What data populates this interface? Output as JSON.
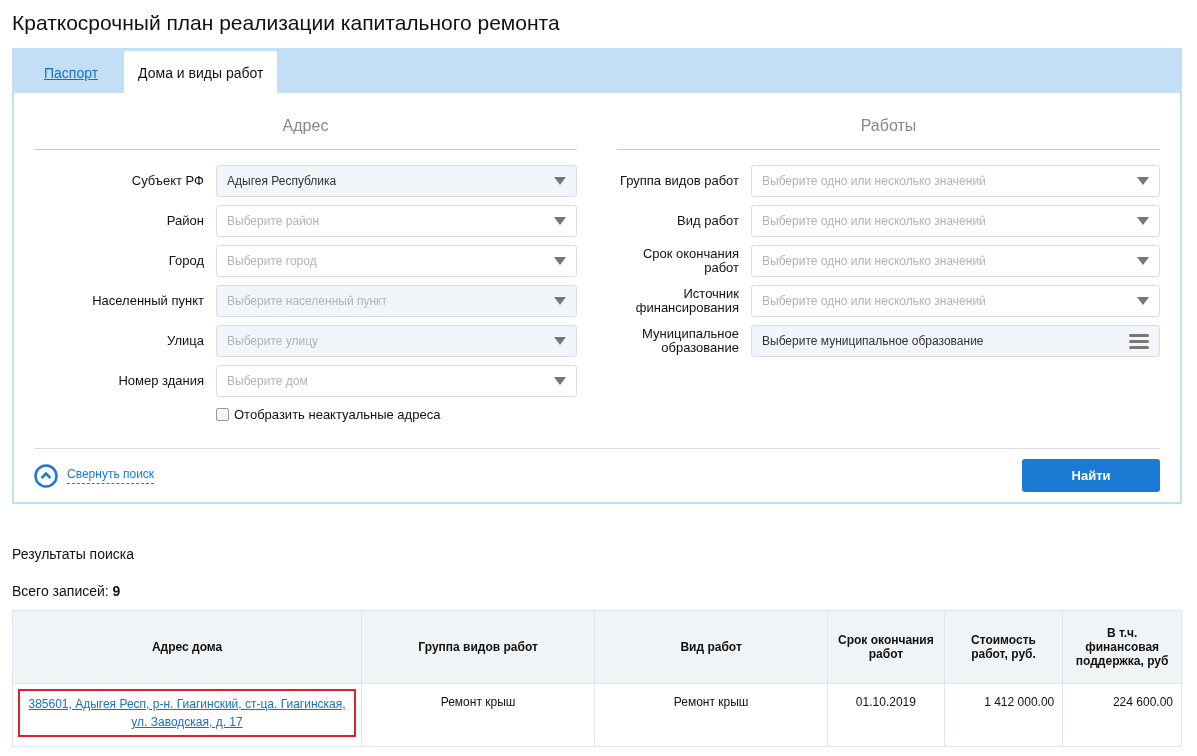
{
  "page_title": "Краткосрочный план реализации капитального ремонта",
  "tabs": [
    {
      "label": "Паспорт",
      "selected": false
    },
    {
      "label": "Дома и виды работ",
      "selected": true
    }
  ],
  "address_section": {
    "heading": "Адрес",
    "fields": [
      {
        "label": "Субъект РФ",
        "kind": "select",
        "value": "Адыгея Республика",
        "disabled": true
      },
      {
        "label": "Район",
        "kind": "select",
        "placeholder": "Выберите район",
        "disabled": false
      },
      {
        "label": "Город",
        "kind": "select",
        "placeholder": "Выберите город",
        "disabled": false
      },
      {
        "label": "Населенный пункт",
        "kind": "select",
        "placeholder": "Выберите населенный пункт",
        "disabled": true
      },
      {
        "label": "Улица",
        "kind": "select",
        "placeholder": "Выберите улицу",
        "disabled": true
      },
      {
        "label": "Номер здания",
        "kind": "select",
        "placeholder": "Выберите дом",
        "disabled": false
      }
    ],
    "checkbox": {
      "label": "Отобразить неактуальные адреса",
      "checked": false
    }
  },
  "works_section": {
    "heading": "Работы",
    "fields": [
      {
        "label": "Группа видов работ",
        "kind": "select",
        "placeholder": "Выберите одно или несколько значений",
        "disabled": false
      },
      {
        "label": "Вид работ",
        "kind": "select",
        "placeholder": "Выберите одно или несколько значений",
        "disabled": false
      },
      {
        "label": "Срок окончания работ",
        "kind": "select",
        "placeholder": "Выберите одно или несколько значений",
        "disabled": false
      },
      {
        "label": "Источник финансирования",
        "kind": "select",
        "placeholder": "Выберите одно или несколько значений",
        "disabled": false
      },
      {
        "label": "Муниципальное образование",
        "kind": "list",
        "value": "Выберите муниципальное образование",
        "disabled": true
      }
    ]
  },
  "collapse_link": "Свернуть поиск",
  "find_button": "Найти",
  "results_title": "Результаты поиска",
  "total": {
    "label": "Всего записей:",
    "count": "9"
  },
  "table": {
    "columns": [
      "Адрес дома",
      "Группа видов работ",
      "Вид работ",
      "Срок окончания работ",
      "Стоимость работ, руб.",
      "В т.ч. финансовая поддержка, руб"
    ],
    "rows": [
      {
        "address": "385601, Адыгея Респ, р-н. Гиагинский, ст-ца. Гиагинская, ул. Заводская, д. 17",
        "highlighted": true,
        "work_group": "Ремонт крыш",
        "work_type": "Ремонт крыш",
        "end_date": "01.10.2019",
        "cost": "1 412 000.00",
        "support": "224 600.00"
      }
    ]
  }
}
